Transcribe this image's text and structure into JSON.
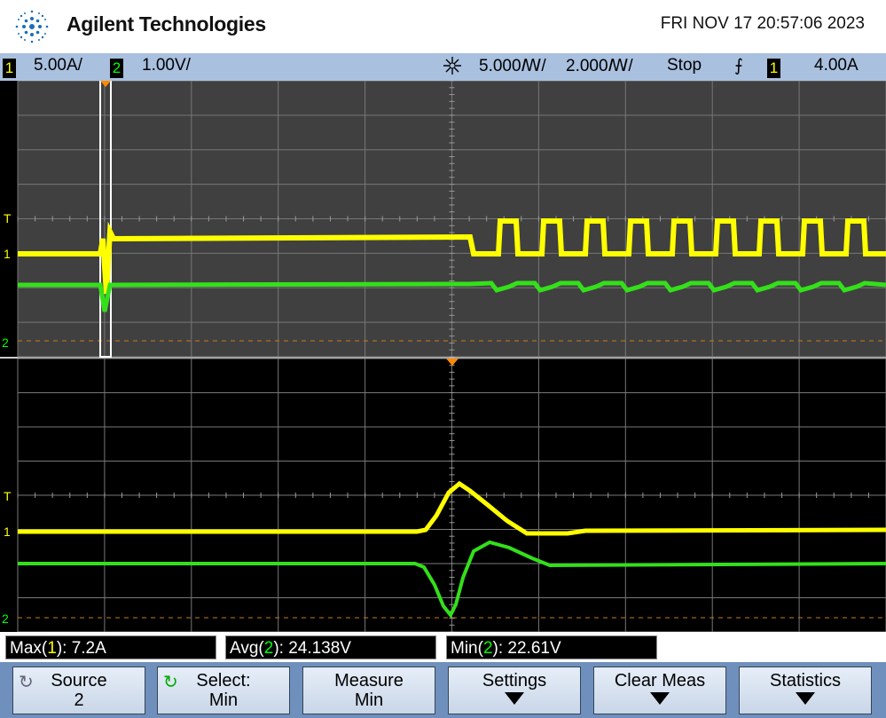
{
  "header": {
    "brand": "Agilent Technologies",
    "datetime": "FRI NOV 17 20:57:06 2023"
  },
  "status": {
    "ch1_num": "1",
    "ch1_scale": "5.00A/",
    "ch2_num": "2",
    "ch2_scale": "1.00V/",
    "timebase": "5.000ꟿ/",
    "delay": "2.000ꟿ/",
    "run_state": "Stop",
    "trigger_slope": "⨍",
    "trig_ch": "1",
    "trig_level": "4.00A"
  },
  "markers": {
    "trig": "T",
    "ch1": "1",
    "ch2": "2"
  },
  "measurements": [
    {
      "pre": "Max(",
      "ch": "1",
      "post": "): 7.2A"
    },
    {
      "pre": "Avg(",
      "ch": "2",
      "post": "): 24.138V"
    },
    {
      "pre": "Min(",
      "ch": "2",
      "post": "): 22.61V"
    }
  ],
  "softkeys": [
    {
      "l1": "Source",
      "l2": "2"
    },
    {
      "l1": "Select:",
      "l2": "Min"
    },
    {
      "l1": "Measure",
      "l2": "Min"
    },
    {
      "l1": "Settings",
      "l2": ""
    },
    {
      "l1": "Clear Meas",
      "l2": ""
    },
    {
      "l1": "Statistics",
      "l2": ""
    }
  ],
  "colors": {
    "ch1": "#ffff00",
    "ch2": "#33e01a",
    "grid_top_bg": "#404040",
    "grid_bottom_bg": "#000000",
    "trigger_marker": "#ff8a00"
  }
}
